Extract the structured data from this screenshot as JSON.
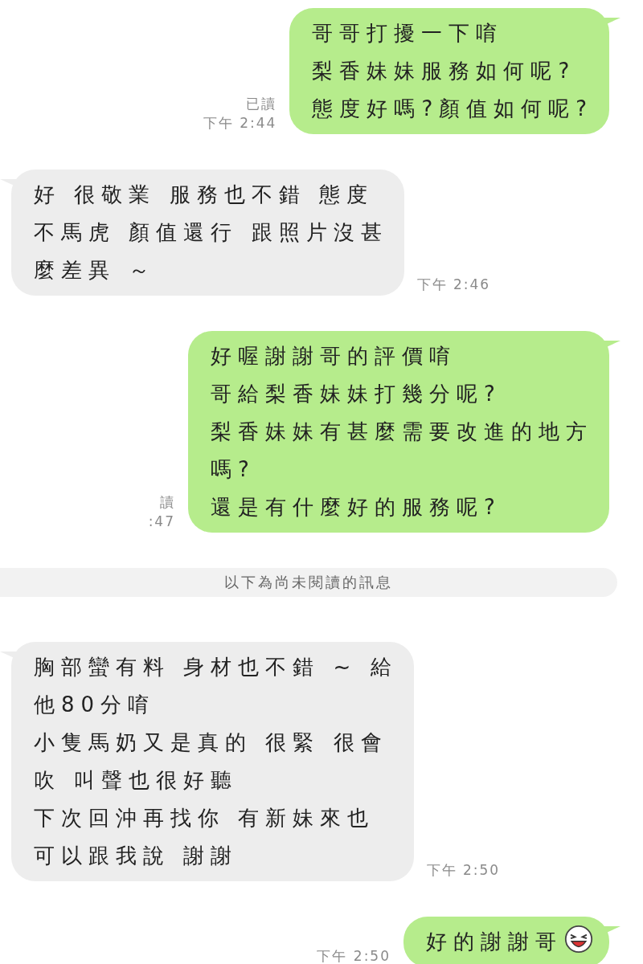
{
  "messages": [
    {
      "kind": "sent",
      "read": "已讀",
      "time": "下午 2:44",
      "lines": [
        "哥哥打擾一下唷",
        "梨香妹妹服務如何呢?",
        "態度好嗎?顏值如何呢?"
      ],
      "sticker": false
    },
    {
      "kind": "received",
      "time": "下午 2:46",
      "lines": [
        "好 很敬業 服務也不錯 態度",
        "不馬虎 顏值還行 跟照片沒甚",
        "麼差異 ～"
      ],
      "sticker": false
    },
    {
      "kind": "sent",
      "read": "讀",
      "time": ":47",
      "lines": [
        "好喔謝謝哥的評價唷",
        "哥給梨香妹妹打幾分呢?",
        "梨香妹妹有甚麼需要改進的地方",
        "嗎?",
        "還是有什麼好的服務呢?"
      ],
      "sticker": false
    },
    {
      "kind": "divider",
      "text": "以下為尚未閱讀的訊息"
    },
    {
      "kind": "received",
      "time": "下午 2:50",
      "lines": [
        "胸部蠻有料 身材也不錯 ~ 給",
        "他80分唷",
        "小隻馬奶又是真的 很緊 很會",
        "吹 叫聲也很好聽",
        "下次回沖再找你 有新妹來也",
        "可以跟我說 謝謝"
      ],
      "sticker": false
    },
    {
      "kind": "sent",
      "time": "下午 2:50",
      "lines": [
        "好的謝謝哥"
      ],
      "sticker": true
    }
  ]
}
